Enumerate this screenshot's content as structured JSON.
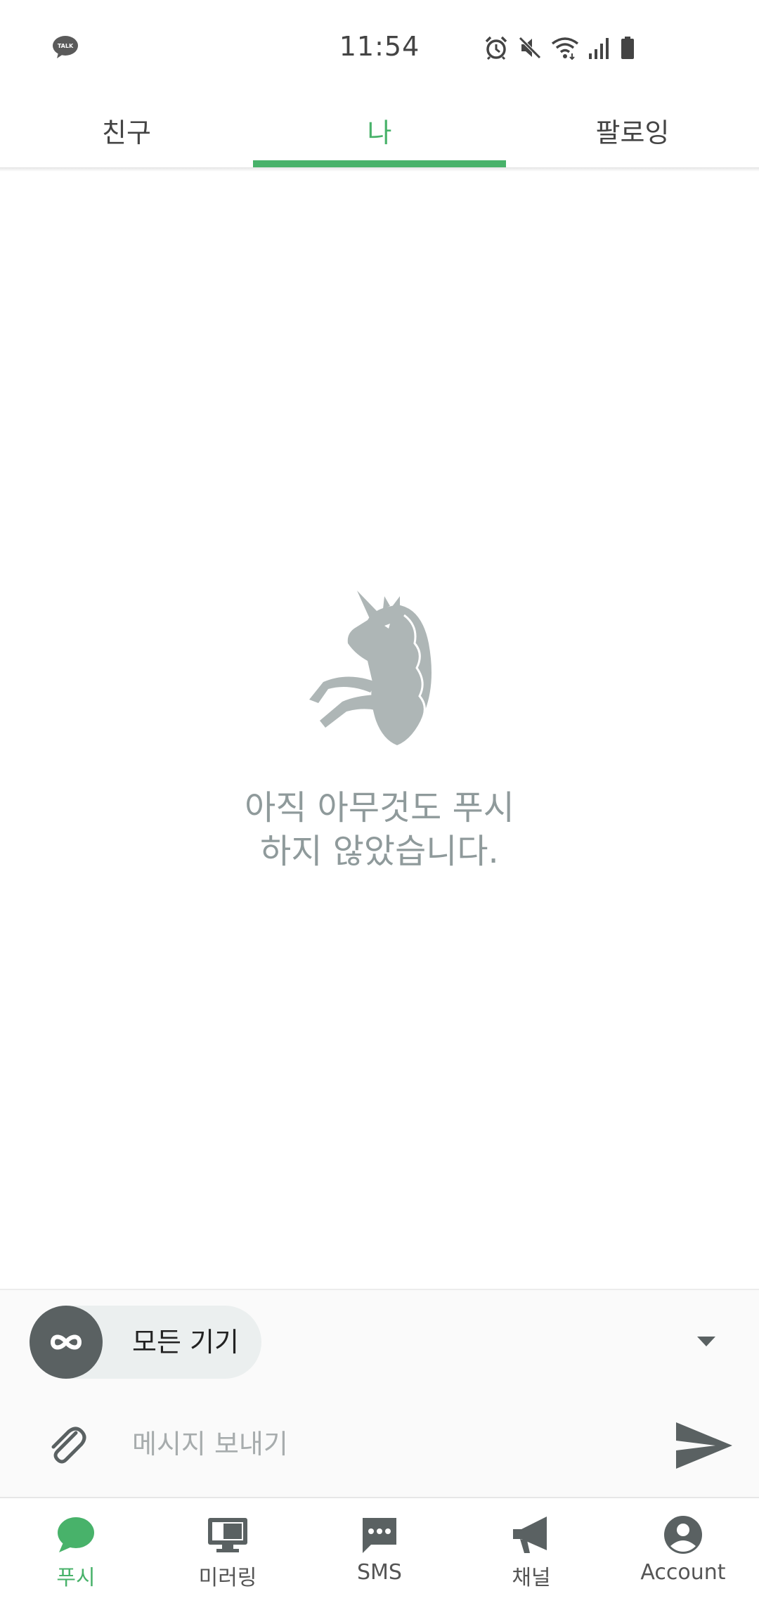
{
  "status_bar": {
    "time": "11:54",
    "app_icon": "kakaotalk-icon",
    "app_icon_text": "TALK",
    "icons": [
      "alarm-icon",
      "mute-icon",
      "wifi-icon",
      "signal-icon",
      "battery-icon"
    ]
  },
  "top_tabs": [
    {
      "label": "친구",
      "active": false
    },
    {
      "label": "나",
      "active": true
    },
    {
      "label": "팔로잉",
      "active": false
    }
  ],
  "empty_state": {
    "icon": "unicorn-icon",
    "message": "아직 아무것도 푸시\n하지 않았습니다."
  },
  "composer": {
    "device_selector": {
      "label": "모든 기기",
      "icon": "infinity-icon"
    },
    "dropdown_icon": "caret-down-icon",
    "attach_icon": "paperclip-icon",
    "placeholder": "메시지 보내기",
    "value": "",
    "send_icon": "send-icon"
  },
  "bottom_nav": [
    {
      "label": "푸시",
      "icon": "chat-bubble-icon",
      "active": true
    },
    {
      "label": "미러링",
      "icon": "monitor-icon",
      "active": false
    },
    {
      "label": "SMS",
      "icon": "sms-icon",
      "active": false
    },
    {
      "label": "채널",
      "icon": "megaphone-icon",
      "active": false
    },
    {
      "label": "Account",
      "icon": "account-icon",
      "active": false
    }
  ],
  "colors": {
    "accent": "#48b26a",
    "muted_text": "#8f9a9b",
    "icon_dark": "#5a6162",
    "pill_bg": "#ebefef"
  }
}
